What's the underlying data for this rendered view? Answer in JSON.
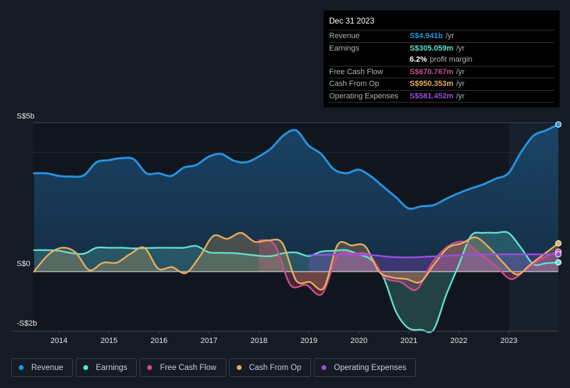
{
  "tooltip": {
    "date": "Dec 31 2023",
    "rows": [
      {
        "label": "Revenue",
        "value": "S$4.941b",
        "unit": "/yr",
        "color": "#2394df"
      },
      {
        "label": "Earnings",
        "value": "S$305.059m",
        "unit": "/yr",
        "color": "#62e0cf"
      },
      {
        "label": "",
        "value": "6.2%",
        "unit": "profit margin",
        "color": "#ffffff"
      },
      {
        "label": "Free Cash Flow",
        "value": "S$670.767m",
        "unit": "/yr",
        "color": "#c94f8a"
      },
      {
        "label": "Cash From Op",
        "value": "S$950.353m",
        "unit": "/yr",
        "color": "#e8ad5c"
      },
      {
        "label": "Operating Expenses",
        "value": "S$581.452m",
        "unit": "/yr",
        "color": "#9b4fe0"
      }
    ]
  },
  "legend": [
    {
      "label": "Revenue",
      "color": "#2394df"
    },
    {
      "label": "Earnings",
      "color": "#62e0cf"
    },
    {
      "label": "Free Cash Flow",
      "color": "#c94f8a"
    },
    {
      "label": "Cash From Op",
      "color": "#e8ad5c"
    },
    {
      "label": "Operating Expenses",
      "color": "#9b4fe0"
    }
  ],
  "chart_data": {
    "type": "area",
    "title": "",
    "xlabel": "",
    "ylabel": "",
    "y_unit": "S$ billions",
    "ylim": [
      -2,
      5
    ],
    "xlim": [
      2013.5,
      2024.0
    ],
    "y_tick_labels": [
      {
        "value": 5,
        "label": "S$5b"
      },
      {
        "value": 0,
        "label": "S$0"
      },
      {
        "value": -2,
        "label": "-S$2b"
      }
    ],
    "gridlines": [
      5,
      4,
      2
    ],
    "x_ticks": [
      2014,
      2015,
      2016,
      2017,
      2018,
      2019,
      2020,
      2021,
      2022,
      2023
    ],
    "x_tick_labels": [
      "2014",
      "2015",
      "2016",
      "2017",
      "2018",
      "2019",
      "2020",
      "2021",
      "2022",
      "2023"
    ],
    "highlight_start": 2023.0,
    "series": [
      {
        "name": "Revenue",
        "color": "#2394df",
        "start": 2013.5,
        "values": [
          3.3,
          3.3,
          3.21,
          3.19,
          3.23,
          3.67,
          3.74,
          3.81,
          3.77,
          3.3,
          3.3,
          3.21,
          3.49,
          3.58,
          3.86,
          3.95,
          3.72,
          3.67,
          3.86,
          4.14,
          4.58,
          4.74,
          4.23,
          3.95,
          3.44,
          3.3,
          3.42,
          3.19,
          2.84,
          2.49,
          2.12,
          2.19,
          2.23,
          2.44,
          2.63,
          2.79,
          2.93,
          3.12,
          3.3,
          4.0,
          4.56,
          4.74,
          4.94
        ]
      },
      {
        "name": "Earnings",
        "color": "#62e0cf",
        "start": 2013.5,
        "values": [
          0.72,
          0.72,
          0.7,
          0.62,
          0.6,
          0.8,
          0.8,
          0.8,
          0.78,
          0.79,
          0.8,
          0.8,
          0.8,
          0.86,
          0.65,
          0.63,
          0.62,
          0.58,
          0.53,
          0.52,
          0.62,
          0.64,
          0.52,
          0.67,
          0.7,
          0.72,
          0.58,
          0.4,
          -0.2,
          -1.35,
          -1.9,
          -1.95,
          -1.95,
          -0.8,
          0.2,
          1.2,
          1.3,
          1.3,
          1.3,
          0.8,
          0.25,
          0.28,
          0.31
        ]
      },
      {
        "name": "Free Cash Flow",
        "color": "#c94f8a",
        "start": 2018.0,
        "values": [
          1.05,
          0.9,
          -0.45,
          -0.45,
          -0.75,
          0.55,
          0.6,
          0.55,
          -0.2,
          -0.35,
          -0.6,
          0.3,
          0.85,
          1.0,
          0.6,
          0.2,
          -0.25,
          0.1,
          0.45,
          0.67
        ]
      },
      {
        "name": "Cash From Op",
        "color": "#e8ad5c",
        "start": 2013.5,
        "values": [
          0.0,
          0.55,
          0.8,
          0.65,
          0.05,
          0.3,
          0.3,
          0.6,
          0.8,
          0.1,
          0.15,
          -0.05,
          0.5,
          1.2,
          1.1,
          1.3,
          1.0,
          1.05,
          0.95,
          -0.3,
          -0.35,
          -0.55,
          0.9,
          0.88,
          0.85,
          0.0,
          -0.2,
          -0.25,
          -0.35,
          0.25,
          0.8,
          0.95,
          1.15,
          0.8,
          0.3,
          -0.1,
          0.25,
          0.6,
          0.95
        ]
      },
      {
        "name": "Operating Expenses",
        "color": "#9b4fe0",
        "start": 2019.0,
        "values": [
          0.55,
          0.56,
          0.57,
          0.57,
          0.57,
          0.55,
          0.5,
          0.48,
          0.48,
          0.5,
          0.52,
          0.54,
          0.56,
          0.58,
          0.58,
          0.58,
          0.58,
          0.58,
          0.58,
          0.58
        ]
      }
    ]
  }
}
